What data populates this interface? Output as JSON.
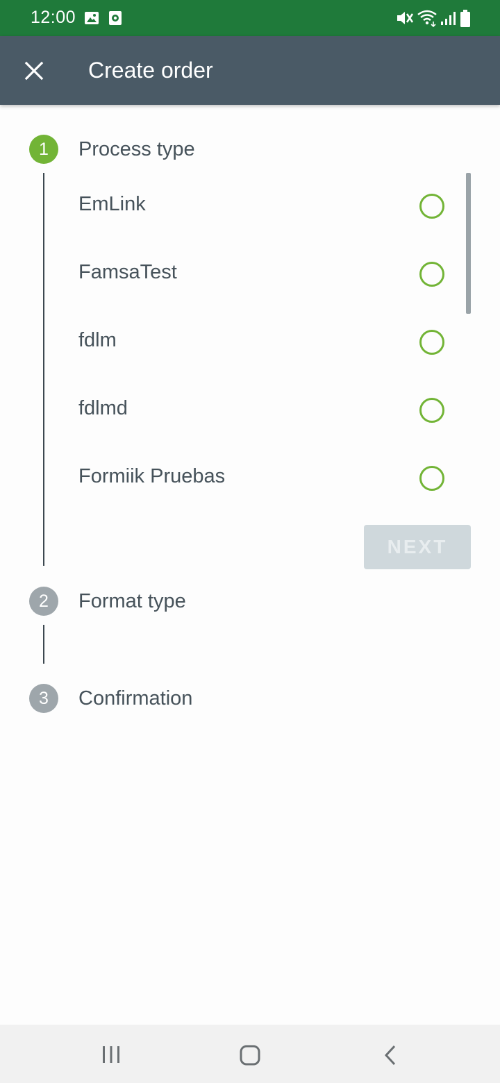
{
  "status_bar": {
    "time": "12:00",
    "icons": [
      "image-icon",
      "record-icon",
      "mute-icon",
      "wifi-icon",
      "signal-icon",
      "battery-icon"
    ]
  },
  "app_bar": {
    "title": "Create order",
    "close_icon": "close-icon"
  },
  "stepper": {
    "steps": [
      {
        "number": "1",
        "label": "Process type",
        "state": "active"
      },
      {
        "number": "2",
        "label": "Format type",
        "state": "inactive"
      },
      {
        "number": "3",
        "label": "Confirmation",
        "state": "inactive"
      }
    ],
    "process_options": [
      {
        "label": "EmLink",
        "selected": false
      },
      {
        "label": "FamsaTest",
        "selected": false
      },
      {
        "label": "fdlm",
        "selected": false
      },
      {
        "label": "fdlmd",
        "selected": false
      },
      {
        "label": "Formiik Pruebas",
        "selected": false
      }
    ],
    "next_label": "NEXT",
    "next_enabled": false
  },
  "nav_bar": {
    "icons": [
      "recent-apps-icon",
      "home-icon",
      "back-icon"
    ]
  },
  "colors": {
    "status_bar": "#1f7a3a",
    "app_bar": "#4a5a66",
    "accent": "#72b436",
    "step_inactive": "#9ea6ab",
    "text": "#46525a",
    "button_disabled": "#cfd8dc"
  }
}
